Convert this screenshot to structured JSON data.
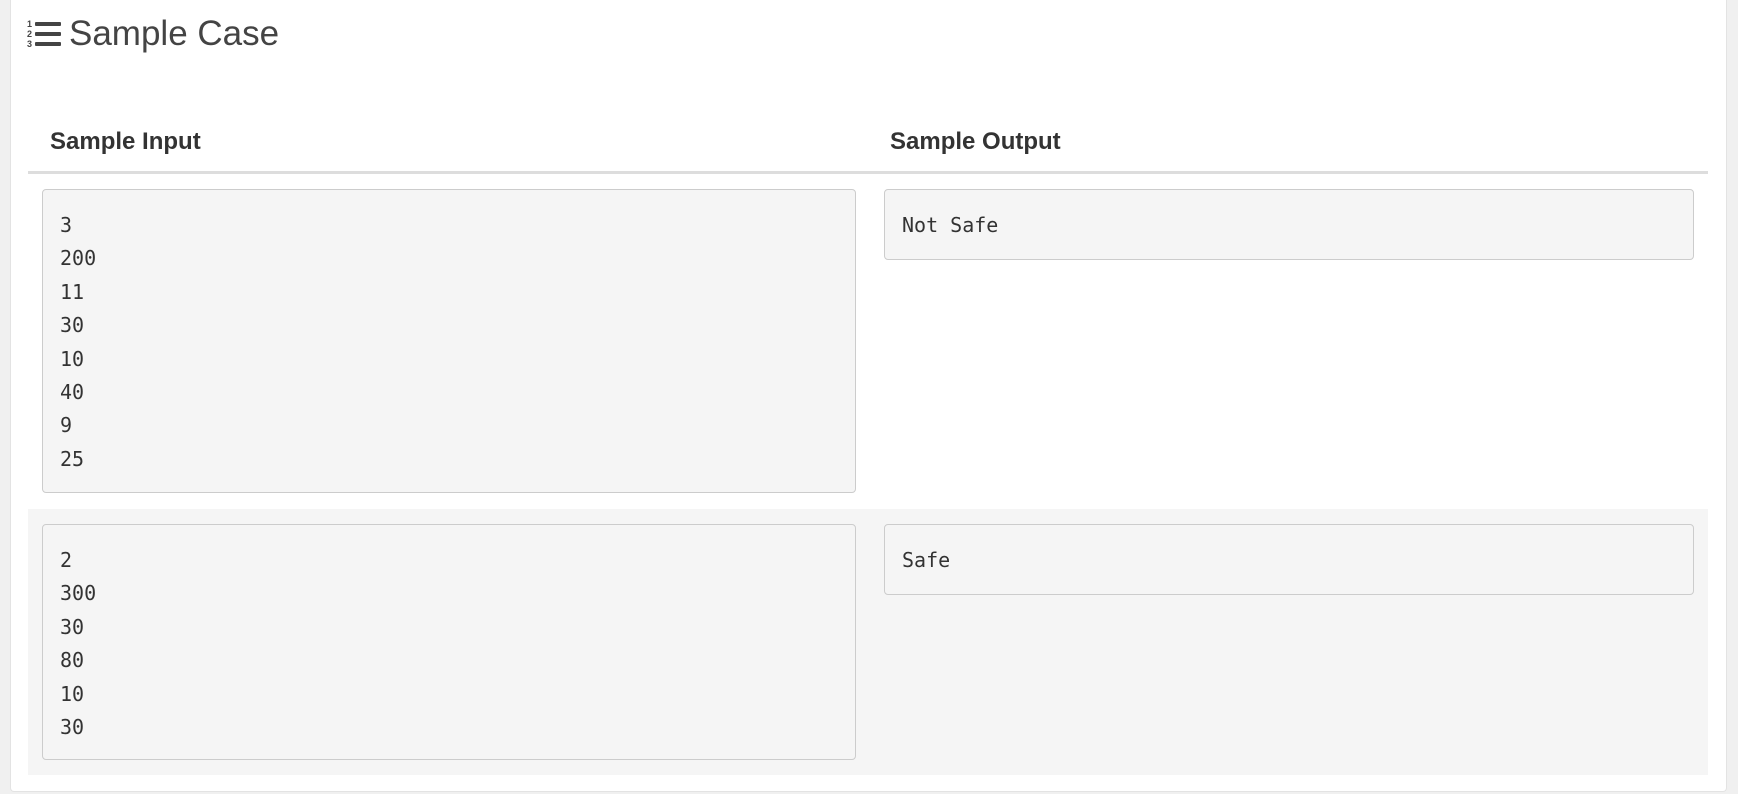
{
  "section": {
    "icon": "ordered-list-icon",
    "title": "Sample Case"
  },
  "table": {
    "headers": {
      "input": "Sample Input",
      "output": "Sample Output"
    },
    "cases": [
      {
        "input": "3\n200\n11\n30\n10\n40\n9\n25",
        "output": "Not Safe"
      },
      {
        "input": "2\n300\n30\n80\n10\n30",
        "output": "Safe"
      }
    ]
  },
  "colors": {
    "text": "#333333",
    "title": "#444444",
    "code_bg": "#f5f5f5",
    "code_border": "#cccccc",
    "row_alt_bg": "#f5f5f5"
  }
}
